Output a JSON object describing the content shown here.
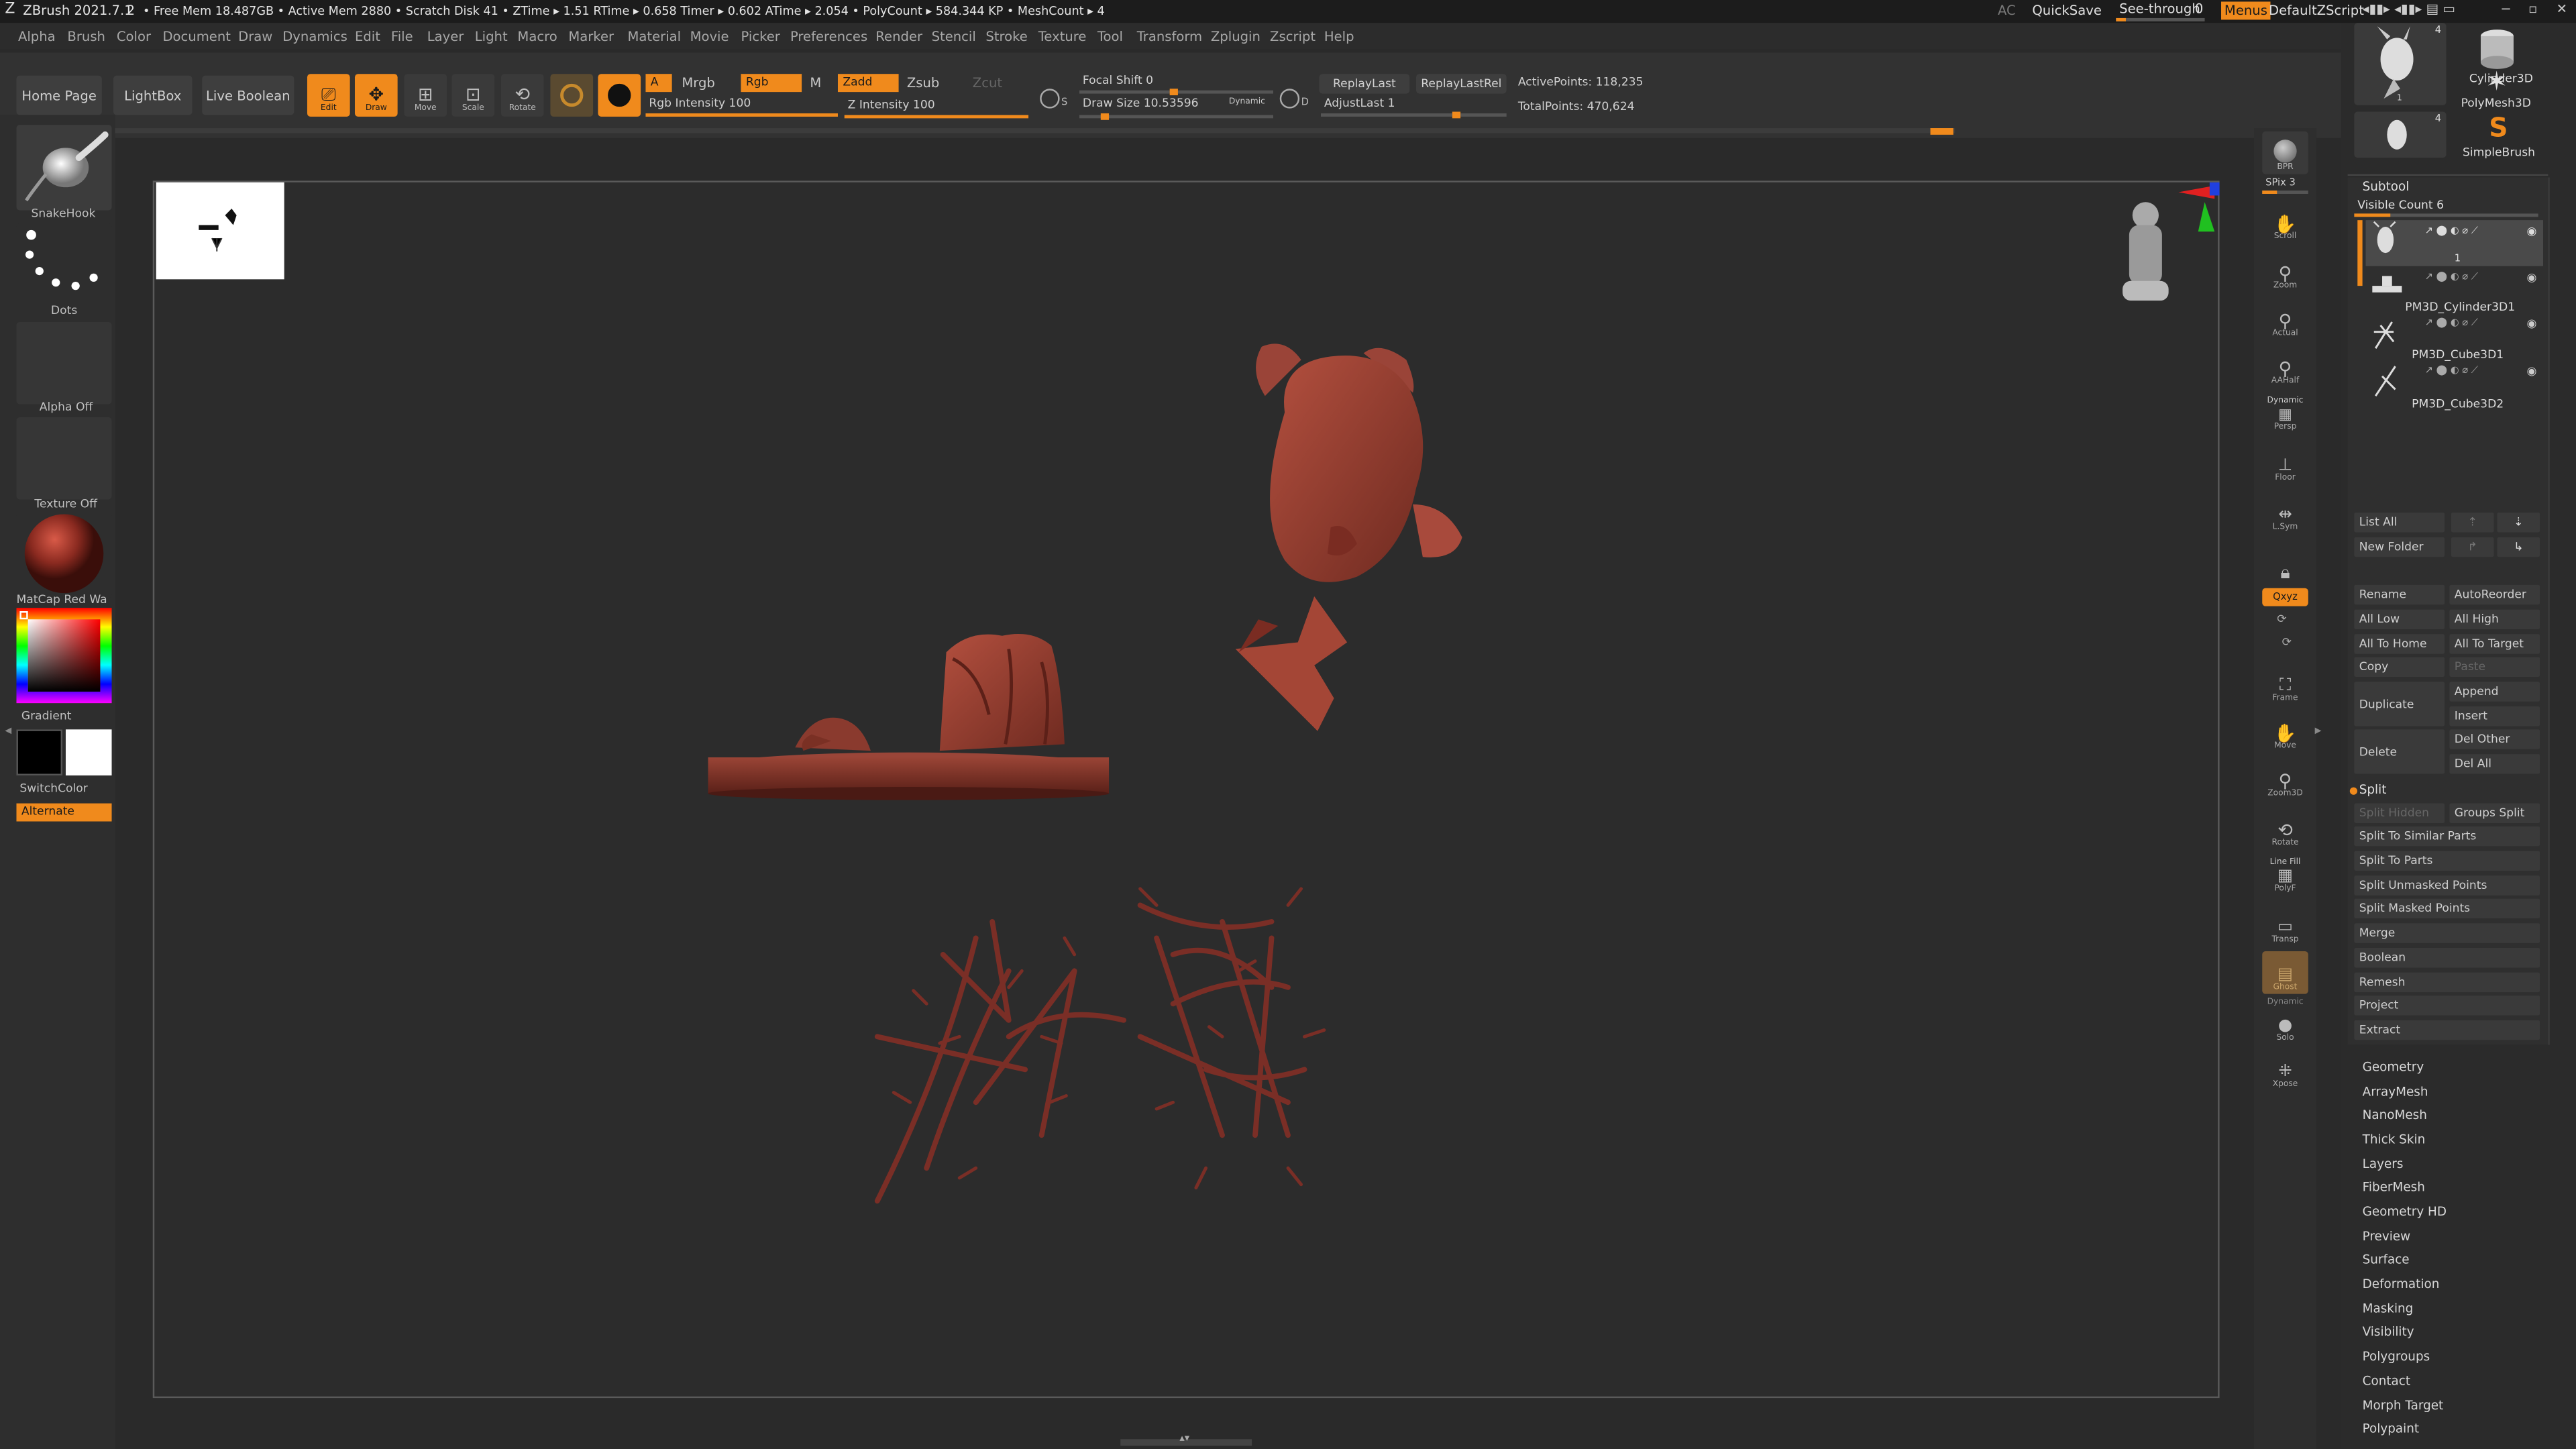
{
  "titlebar": {
    "app": "ZBrush 2021.7.1",
    "doc_index": "2",
    "stats": "• Free Mem 18.487GB • Active Mem 2880 • Scratch Disk 41 • ZTime ▸ 1.51 RTime ▸ 0.658 Timer ▸ 0.602 ATime ▸ 2.054 • PolyCount ▸ 584.344 KP • MeshCount ▸ 4",
    "ac": "AC",
    "quicksave": "QuickSave",
    "see_through": "See-through",
    "see_through_value": "0",
    "menus": "Menus",
    "script": "DefaultZScript"
  },
  "menubar": [
    "Alpha",
    "Brush",
    "Color",
    "Document",
    "Draw",
    "Dynamics",
    "Edit",
    "File",
    "Layer",
    "Light",
    "Macro",
    "Marker",
    "Material",
    "Movie",
    "Picker",
    "Preferences",
    "Render",
    "Stencil",
    "Stroke",
    "Texture",
    "Tool",
    "Transform",
    "Zplugin",
    "Zscript",
    "Help"
  ],
  "toolbar": {
    "home_page": "Home Page",
    "lightbox": "LightBox",
    "live_boolean": "Live Boolean",
    "edit": "Edit",
    "draw": "Draw",
    "move": "Move",
    "scale": "Scale",
    "rotate": "Rotate",
    "a": "A",
    "mrgb": "Mrgb",
    "rgb": "Rgb",
    "m": "M",
    "rgb_intensity": "Rgb Intensity 100",
    "zadd": "Zadd",
    "zsub": "Zsub",
    "zcut": "Zcut",
    "z_intensity": "Z Intensity 100",
    "focal_shift": "Focal Shift 0",
    "draw_size": "Draw Size 10.53596",
    "dynamic": "Dynamic",
    "replay_last": "ReplayLast",
    "replay_last_rel": "ReplayLastRel",
    "adjust_last": "AdjustLast 1",
    "active_points": "ActivePoints: 118,235",
    "total_points": "TotalPoints: 470,624",
    "s_label": "S",
    "d_label": "D",
    "rgb_intensity_value": 100,
    "z_intensity_value": 100
  },
  "left_shelf": {
    "brush": "SnakeHook",
    "stroke": "Dots",
    "alpha": "Alpha Off",
    "texture": "Texture Off",
    "material": "MatCap Red Wa",
    "gradient": "Gradient",
    "switch_color": "SwitchColor",
    "alternate": "Alternate"
  },
  "right_shelf": {
    "bpr": "BPR",
    "spix": "SPix 3",
    "scroll": "Scroll",
    "zoom": "Zoom",
    "actual": "Actual",
    "aahalf": "AAHalf",
    "dynamic": "Dynamic",
    "persp": "Persp",
    "floor": "Floor",
    "lsym": "L.Sym",
    "xyz": "Qxyz",
    "frame": "Frame",
    "move": "Move",
    "zoom3d": "Zoom3D",
    "rotate": "Rotate",
    "line_fill": "Line Fill",
    "polyf": "PolyF",
    "transp": "Transp",
    "ghost": "Ghost",
    "solo": "Solo",
    "xpose": "Xpose"
  },
  "tool_tray": {
    "thumb_count_1": "4",
    "thumb_count_2": "4",
    "thumb_num": "1",
    "cylinder": "Cylinder3D",
    "polymesh": "PolyMesh3D",
    "simplebrush": "SimpleBrush"
  },
  "subtool": {
    "header": "Subtool",
    "visible_count": "Visible Count 6",
    "items": [
      "1",
      "PM3D_Cylinder3D1",
      "PM3D_Cube3D1",
      "PM3D_Cube3D2"
    ],
    "list_all": "List All",
    "new_folder": "New Folder",
    "rename": "Rename",
    "auto_reorder": "AutoReorder",
    "all_low": "All Low",
    "all_high": "All High",
    "all_to_home": "All To Home",
    "all_to_target": "All To Target",
    "copy": "Copy",
    "paste": "Paste",
    "duplicate": "Duplicate",
    "append": "Append",
    "insert": "Insert",
    "delete": "Delete",
    "del_other": "Del Other",
    "del_all": "Del All",
    "split": "Split",
    "split_hidden": "Split Hidden",
    "groups_split": "Groups Split",
    "split_similar": "Split To Similar Parts",
    "split_parts": "Split To Parts",
    "split_unmasked": "Split Unmasked Points",
    "split_masked": "Split Masked Points",
    "merge": "Merge",
    "boolean": "Boolean",
    "remesh": "Remesh",
    "project": "Project",
    "extract": "Extract"
  },
  "tool_sections": [
    "Geometry",
    "ArrayMesh",
    "NanoMesh",
    "Thick Skin",
    "Layers",
    "FiberMesh",
    "Geometry HD",
    "Preview",
    "Surface",
    "Deformation",
    "Masking",
    "Visibility",
    "Polygroups",
    "Contact",
    "Morph Target",
    "Polypaint"
  ],
  "colors": {
    "accent": "#f08a1c",
    "model": "#8a3a2e",
    "model_light": "#b0503e"
  }
}
